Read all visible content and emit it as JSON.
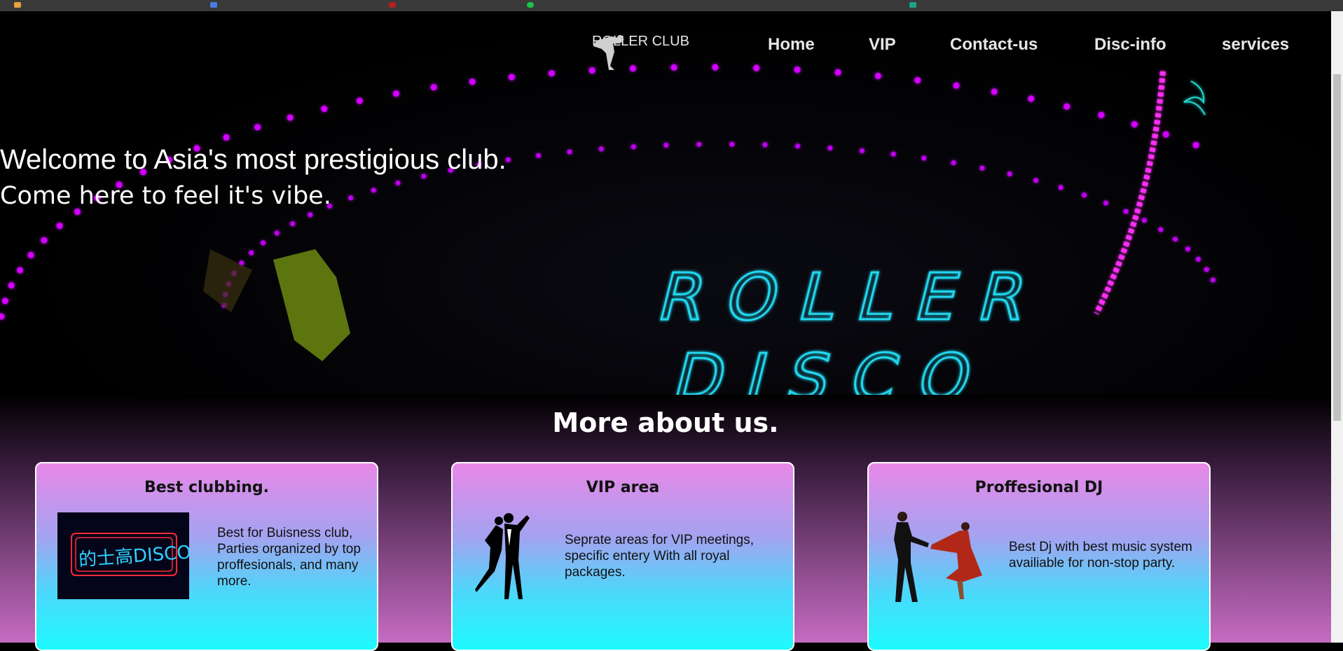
{
  "nav": {
    "logo_text": "ROLLER CLUB",
    "items": [
      {
        "label": "Home"
      },
      {
        "label": "VIP"
      },
      {
        "label": "Contact-us"
      },
      {
        "label": "Disc-info"
      },
      {
        "label": "services"
      }
    ]
  },
  "hero": {
    "headline": "Welcome to Asia's most prestigious club.",
    "subheadline": "Come here to feel it's vibe.",
    "sign_line1": "ROLLER",
    "sign_line2": "DISCO"
  },
  "about": {
    "title": "More about us.",
    "cards": [
      {
        "title": "Best clubbing.",
        "text": "Best for Buisness club, Parties organized by top proffesionals, and many more.",
        "image_sign": "的士高DISCO"
      },
      {
        "title": "VIP area",
        "text": "Seprate areas for VIP meetings, specific entery With all royal packages."
      },
      {
        "title": "Proffesional DJ",
        "text": "Best Dj with best music system availiable for non-stop party."
      }
    ]
  },
  "colors": {
    "neon_purple": "#d300ff",
    "neon_cyan": "#20d8f0",
    "card_top": "#e987e8",
    "card_bottom": "#1efafe"
  }
}
